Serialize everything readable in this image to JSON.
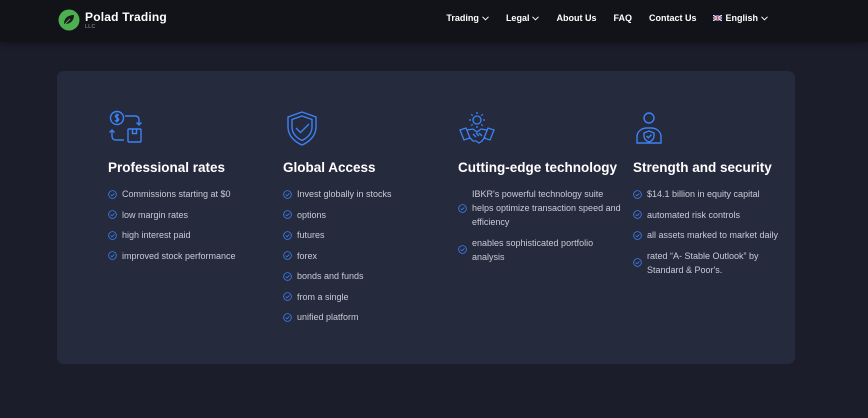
{
  "brand": {
    "name": "Polad Trading",
    "sub": "LLC"
  },
  "nav": {
    "items": [
      {
        "label": "Trading",
        "dropdown": true
      },
      {
        "label": "Legal",
        "dropdown": true
      },
      {
        "label": "About Us",
        "dropdown": false
      },
      {
        "label": "FAQ",
        "dropdown": false
      },
      {
        "label": "Contact Us",
        "dropdown": false
      }
    ],
    "language": "English"
  },
  "colors": {
    "accent": "#3b82f6",
    "page_bg": "#1c1d2b",
    "card_bg": "#262a3d",
    "logo_green": "#4caf50"
  },
  "columns": [
    {
      "icon": "currency-exchange-icon",
      "title": "Professional rates",
      "features": [
        "Commissions starting at $0",
        "low margin rates",
        "high interest paid",
        "improved stock performance"
      ]
    },
    {
      "icon": "shield-check-icon",
      "title": "Global Access",
      "features": [
        "Invest globally in stocks",
        "options",
        "futures",
        "forex",
        "bonds and funds",
        "from a single",
        "unified platform"
      ]
    },
    {
      "icon": "handshake-gear-icon",
      "title": "Cutting-edge technology",
      "features": [
        "IBKR's powerful technology suite helps optimize transaction speed and efficiency",
        "enables sophisticated portfolio analysis"
      ]
    },
    {
      "icon": "user-shield-icon",
      "title": "Strength and security",
      "features": [
        "$14.1 billion in equity capital",
        "automated risk controls",
        "all assets marked to market daily",
        "rated “A- Stable Outlook” by Standard & Poor's."
      ]
    }
  ]
}
